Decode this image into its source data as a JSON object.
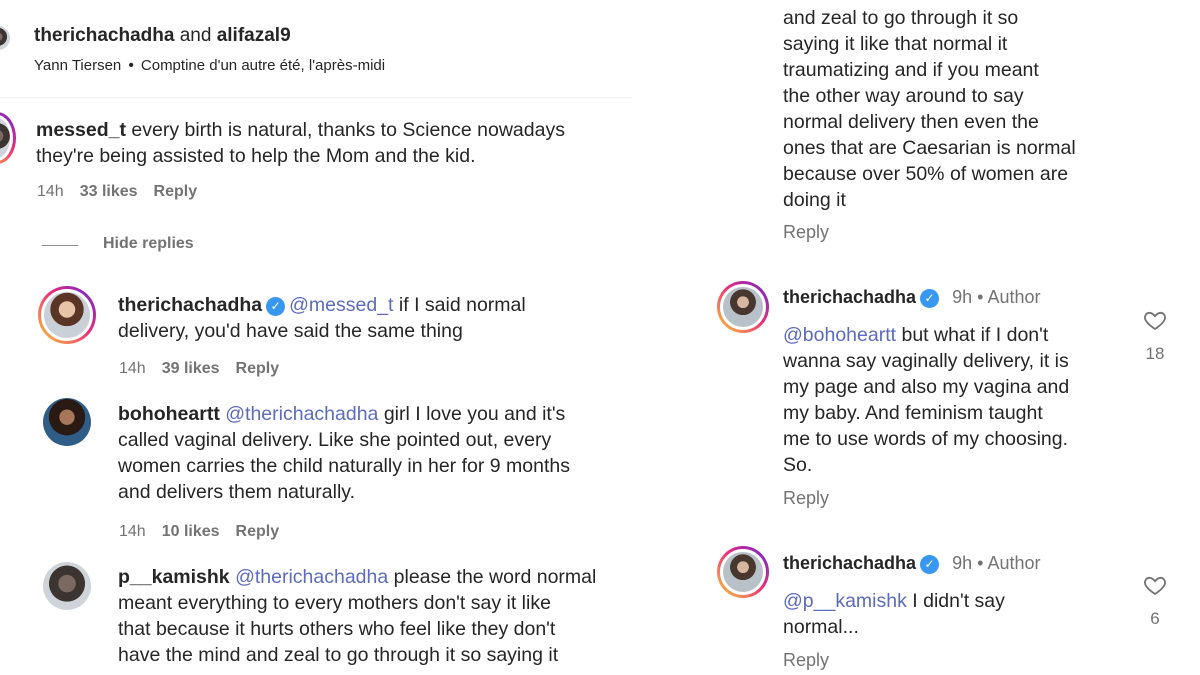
{
  "left": {
    "header": {
      "users": "therichachadha",
      "and": "and",
      "user2": "alifazal9",
      "song_artist": "Yann Tiersen",
      "bullet": "•",
      "song_title": "Comptine d'un autre été, l'après-midi"
    },
    "comment1": {
      "username": "messed_t",
      "text_line1": "every birth is natural, thanks to Science nowadays",
      "text_line2": "they're being assisted to help the Mom and the kid.",
      "time": "14h",
      "likes": "33 likes",
      "reply": "Reply"
    },
    "hide_replies": "Hide replies",
    "reply1": {
      "username": "therichachadha",
      "mention": "@messed_t",
      "text_line1": "if I said normal",
      "text_line2": "delivery, you'd have said the same thing",
      "time": "14h",
      "likes": "39 likes",
      "reply": "Reply"
    },
    "reply2": {
      "username": "bohoheartt",
      "mention": "@therichachadha",
      "text_line1": "girl I love you and it's",
      "text_line2": "called vaginal delivery. Like she pointed out, every",
      "text_line3": "women carries the child naturally in her for 9 months",
      "text_line4": "and delivers them naturally.",
      "time": "14h",
      "likes": "10 likes",
      "reply": "Reply"
    },
    "reply3": {
      "username": "p__kamishk",
      "mention": "@therichachadha",
      "text_line1": "please the word normal",
      "text_line2": "meant everything to every mothers don't say it like",
      "text_line3": "that because it hurts others who feel like they don't",
      "text_line4": "have the mind and zeal to go through it so saying it"
    }
  },
  "right": {
    "cont": {
      "lines": [
        "and zeal to go through it so",
        "saying it like that normal it",
        "traumatizing and if you meant",
        "the other way around to say",
        "normal delivery then even the",
        "ones that are Caesarian is normal",
        "because over 50% of women are",
        "doing it"
      ],
      "reply": "Reply"
    },
    "reply4": {
      "username": "therichachadha",
      "time": "9h",
      "bullet": "•",
      "author": "Author",
      "mention": "@bohoheartt",
      "text_line1": "but what if I don't",
      "text_line2": "wanna say vaginally delivery, it is",
      "text_line3": "my page and also my vagina and",
      "text_line4": "my baby. And feminism taught",
      "text_line5": "me to use words of my choosing.",
      "text_line6": "So.",
      "reply": "Reply",
      "like_count": "18"
    },
    "reply5": {
      "username": "therichachadha",
      "time": "9h",
      "bullet": "•",
      "author": "Author",
      "mention": "@p__kamishk",
      "text_line1": "I didn't say",
      "text_line2": "normal...",
      "reply": "Reply",
      "like_count": "6"
    }
  },
  "colors": {
    "mention": "#5b6bbf",
    "verified": "#3897f0",
    "muted": "#737373"
  }
}
